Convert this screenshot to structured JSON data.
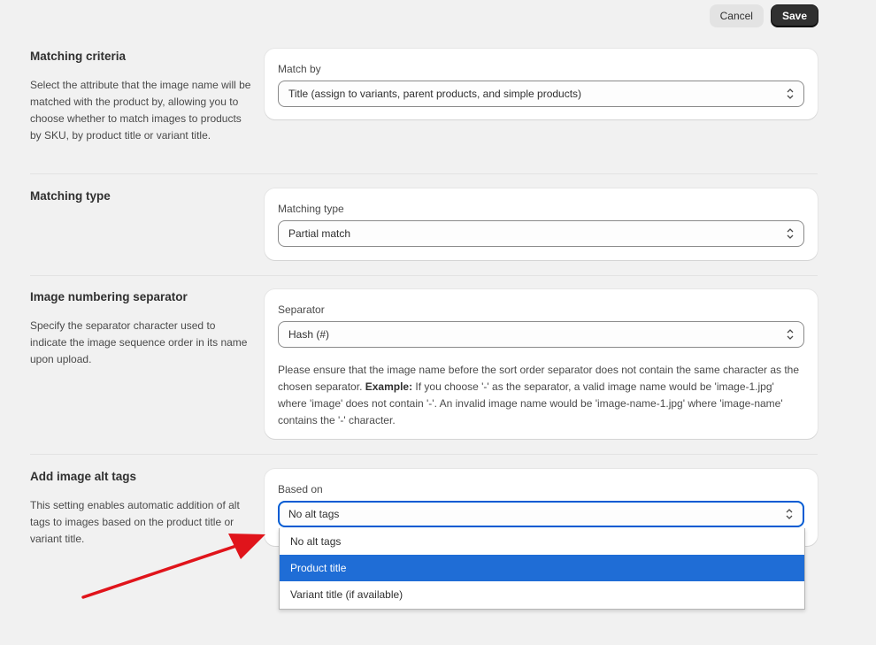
{
  "toolbar": {
    "cancel_label": "Cancel",
    "save_label": "Save"
  },
  "sections": {
    "matching_criteria": {
      "title": "Matching criteria",
      "description": "Select the attribute that the image name will be matched with the product by, allowing you to choose whether to match images to products by SKU, by product title or variant title.",
      "field_label": "Match by",
      "value": "Title (assign to variants, parent products, and simple products)"
    },
    "matching_type": {
      "title": "Matching type",
      "field_label": "Matching type",
      "value": "Partial match"
    },
    "separator": {
      "title": "Image numbering separator",
      "description": "Specify the separator character used to indicate the image sequence order in its name upon upload.",
      "field_label": "Separator",
      "value": "Hash (#)",
      "note_before": "Please ensure that the image name before the sort order separator does not contain the same character as the chosen separator. ",
      "note_bold": "Example:",
      "note_after": " If you choose '-' as the separator, a valid image name would be 'image-1.jpg' where 'image' does not contain '-'. An invalid image name would be 'image-name-1.jpg' where 'image-name' contains the '-' character."
    },
    "alt_tags": {
      "title": "Add image alt tags",
      "description": "This setting enables automatic addition of alt tags to images based on the product title or variant title.",
      "field_label": "Based on",
      "value": "No alt tags",
      "options": [
        "No alt tags",
        "Product title",
        "Variant title (if available)"
      ],
      "highlighted_option": "Product title"
    }
  },
  "colors": {
    "accent": "#005bd3",
    "highlight": "#1f6dd6",
    "annotation_arrow": "#e0141b"
  },
  "icons": {
    "select": "chevron-up-down-icon"
  }
}
